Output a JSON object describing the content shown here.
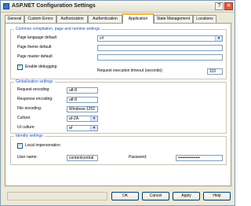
{
  "window": {
    "title": "ASP.NET Configuration Settings",
    "help_label": "?",
    "close_label": "✕"
  },
  "tabs": [
    {
      "label": "General"
    },
    {
      "label": "Custom Errors"
    },
    {
      "label": "Authorization"
    },
    {
      "label": "Authentication"
    },
    {
      "label": "Application"
    },
    {
      "label": "State Management"
    },
    {
      "label": "Locations"
    }
  ],
  "compilation": {
    "title": "Common compilation, page and runtime settings",
    "page_language_label": "Page language default",
    "page_language_value": "c#",
    "page_theme_label": "Page theme default",
    "page_theme_value": "",
    "page_master_label": "Page master default",
    "page_master_value": "",
    "enable_debugging_label": "Enable debugging",
    "enable_debugging_checked": true,
    "timeout_label": "Request execution timeout (seconds):",
    "timeout_value": "110"
  },
  "globalization": {
    "title": "Globalization settings",
    "request_encoding_label": "Request encoding:",
    "request_encoding_value": "utf-8",
    "response_encoding_label": "Response encoding:",
    "response_encoding_value": "utf-8",
    "file_encoding_label": "File encoding:",
    "file_encoding_value": "Windows-1252",
    "culture_label": "Culture:",
    "culture_value": "af-ZA",
    "ui_culture_label": "UI culture:",
    "ui_culture_value": "af"
  },
  "identity": {
    "title": "Identity settings",
    "local_impersonation_label": "Local impersonation",
    "local_impersonation_checked": true,
    "user_name_label": "User name:",
    "user_name_value": "contentcentral",
    "password_label": "Password:",
    "password_value": "••••••••••••••••"
  },
  "buttons": {
    "ok": "OK",
    "cancel": "Cancel",
    "apply": "Apply",
    "help": "Help"
  },
  "colors": {
    "group_title": "#2154b7",
    "active_tab_accent": "#f5b742",
    "checkmark": "#21a121"
  }
}
